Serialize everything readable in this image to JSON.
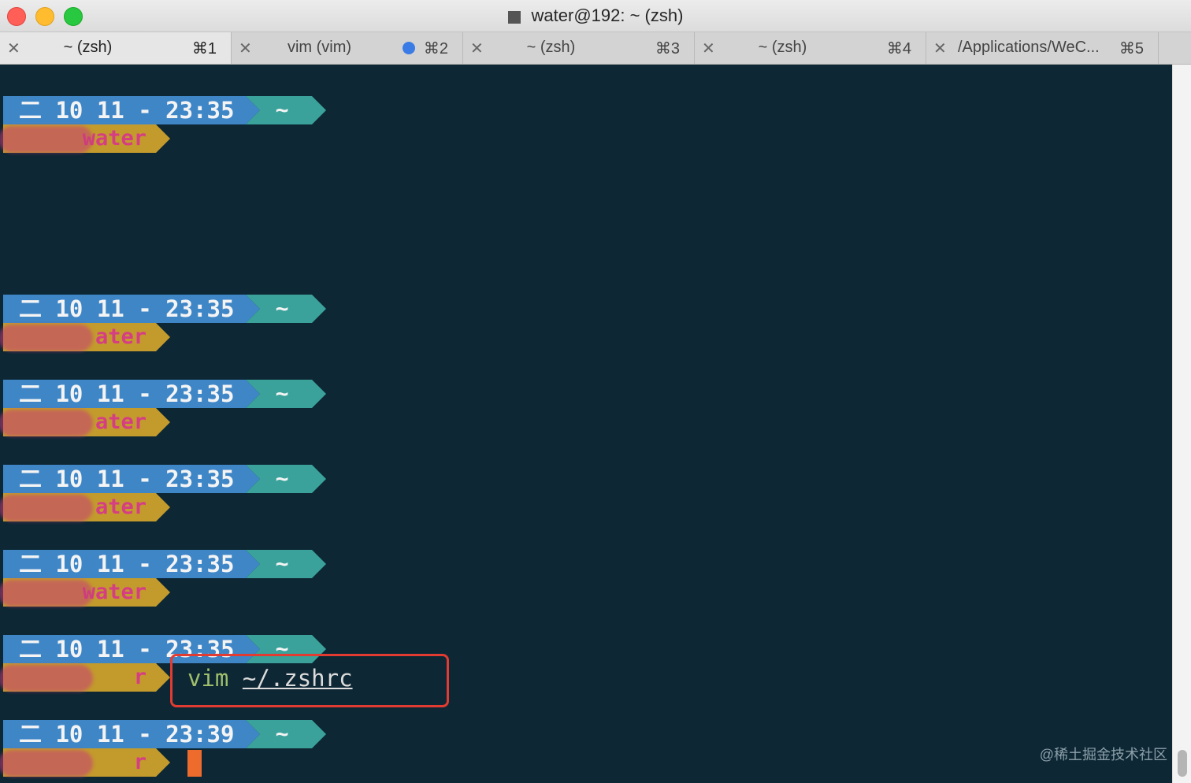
{
  "window": {
    "title": "water@192: ~ (zsh)"
  },
  "tabs": [
    {
      "label": "~ (zsh)",
      "shortcut": "⌘1",
      "active": true,
      "has_dot": false
    },
    {
      "label": "vim (vim)",
      "shortcut": "⌘2",
      "active": false,
      "has_dot": true
    },
    {
      "label": "~ (zsh)",
      "shortcut": "⌘3",
      "active": false,
      "has_dot": false
    },
    {
      "label": "~ (zsh)",
      "shortcut": "⌘4",
      "active": false,
      "has_dot": false
    },
    {
      "label": "/Applications/WeC...",
      "shortcut": "⌘5",
      "active": false,
      "has_dot": false
    }
  ],
  "close_glyph": "✕",
  "prompts": [
    {
      "datetime": "二 10 11 - 23:35",
      "dir": "~",
      "user": "water",
      "command": null
    },
    {
      "datetime": "二 10 11 - 23:35",
      "dir": "~",
      "user": "ater",
      "command": null
    },
    {
      "datetime": "二 10 11 - 23:35",
      "dir": "~",
      "user": "ater",
      "command": null
    },
    {
      "datetime": "二 10 11 - 23:35",
      "dir": "~",
      "user": "ater",
      "command": null
    },
    {
      "datetime": "二 10 11 - 23:35",
      "dir": "~",
      "user": "water",
      "command": null
    },
    {
      "datetime": "二 10 11 - 23:35",
      "dir": "~",
      "user": "r",
      "command": {
        "cmd": "vim",
        "arg": "~/.zshrc"
      }
    },
    {
      "datetime": "二 10 11 - 23:39",
      "dir": "~",
      "user": "r",
      "command": null
    }
  ],
  "watermark": "@稀土掘金技术社区",
  "colors": {
    "terminal_bg": "#0d2734",
    "segment_time": "#3f86c7",
    "segment_dir": "#3aa29a",
    "segment_user": "#c39b2c",
    "user_text": "#d63e83",
    "highlight_border": "#e23b32",
    "cursor": "#ee6b2e",
    "tab_dot": "#3b7be6"
  }
}
